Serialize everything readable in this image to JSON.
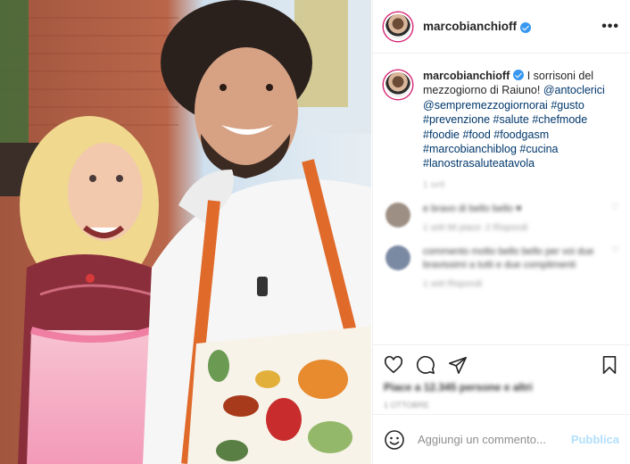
{
  "post": {
    "username": "marcobianchioff",
    "caption_text": "I sorrisoni del mezzogiorno di Raiuno!",
    "mentions": [
      "@antoclerici",
      "@sempremezzogiornorai"
    ],
    "hashtags": [
      "#gusto",
      "#prevenzione",
      "#salute",
      "#chefmode",
      "#foodie",
      "#food",
      "#foodgasm",
      "#marcobianchiblog",
      "#cucina",
      "#lanostrasaluteatavola"
    ],
    "time_blurred": "1 sett",
    "comments": [
      {
        "text_blurred": "e bravo di bello bello ♥",
        "meta_blurred": "1 sett   Mi piace: 2   Rispondi",
        "avatar_color": "#9d8f84"
      },
      {
        "text_blurred": "commento molto bello bello per voi due bravissimi a tutti e due complimenti",
        "meta_blurred": "1 sett   Rispondi",
        "avatar_color": "#7b8aa3"
      }
    ],
    "likes_blurred": "Piace a 12.345 persone e altri",
    "date_blurred": "1 OTTOBRE"
  },
  "comment_box": {
    "placeholder": "Aggiungi un commento...",
    "publish_label": "Pubblica"
  },
  "colors": {
    "hashtag": "#00376b",
    "verified": "#3897f0",
    "publish": "#b2dffc"
  },
  "icons": [
    "more-icon",
    "heart-icon",
    "comment-icon",
    "share-icon",
    "bookmark-icon",
    "emoji-icon",
    "verified-icon"
  ]
}
